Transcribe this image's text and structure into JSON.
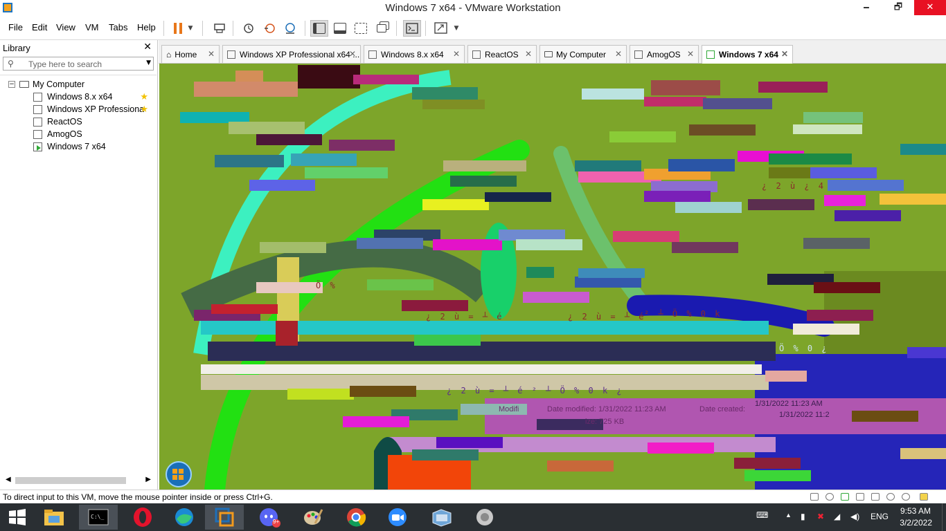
{
  "window": {
    "title": "Windows 7 x64 - VMware Workstation",
    "minimize": "🗕",
    "maximize": "🗗",
    "close": "✕"
  },
  "menu": {
    "file": "File",
    "edit": "Edit",
    "view": "View",
    "vm": "VM",
    "tabs": "Tabs",
    "help": "Help"
  },
  "toolbar_icons": [
    "pause-icon",
    "send-keys-icon",
    "snapshot-icon",
    "revert-snapshot-icon",
    "snapshot-manager-icon",
    "library-view-icon",
    "thumbnail-view-icon",
    "fullscreen-icon",
    "unity-icon",
    "console-icon",
    "stretch-icon"
  ],
  "library": {
    "title": "Library",
    "close": "✕",
    "search_placeholder": "Type here to search",
    "tree": {
      "root": "My Computer",
      "items": [
        {
          "label": "Windows 8.x x64",
          "favorite": true,
          "running": false
        },
        {
          "label": "Windows XP Professiona",
          "favorite": true,
          "running": false
        },
        {
          "label": "ReactOS",
          "favorite": false,
          "running": false
        },
        {
          "label": "AmogOS",
          "favorite": false,
          "running": false
        },
        {
          "label": "Windows 7 x64",
          "favorite": false,
          "running": true
        }
      ]
    }
  },
  "tabs": [
    {
      "label": "Home",
      "active": false
    },
    {
      "label": "Windows XP Professional x64 ...",
      "active": false
    },
    {
      "label": "Windows 8.x x64",
      "active": false
    },
    {
      "label": "ReactOS",
      "active": false
    },
    {
      "label": "My Computer",
      "active": false
    },
    {
      "label": "AmogOS",
      "active": false
    },
    {
      "label": "Windows 7 x64",
      "active": true
    }
  ],
  "vm_screen": {
    "glitch_texts": [
      "¿ 2 ù = ┴ é",
      "¿ 2 ù = ┴ é",
      "² ┴ Ö % 0 k",
      "¿ 2 ù = ┴ é  ² ┴ Ö % 0 k ¿",
      "Ö %",
      "¿ 2 ù ¿ 4",
      "Ö % 0 ¿"
    ],
    "date_texts": [
      "1/31/2022 11:23 AM",
      "1/31/2022 11:2",
      "Date modified: 1/31/2022 11:23 AM",
      "Date created:",
      "ize: 725 KB",
      "Modifi"
    ]
  },
  "status": {
    "text": "To direct input to this VM, move the mouse pointer inside or press Ctrl+G."
  },
  "taskbar": {
    "apps": [
      "start-button",
      "file-explorer-icon",
      "command-prompt-icon",
      "opera-icon",
      "edge-icon",
      "vmware-icon",
      "discord-icon",
      "paint-icon",
      "chrome-icon",
      "zoom-icon",
      "virtualbox-icon",
      "speaker-app-icon"
    ],
    "discord_badge": "9+",
    "language": "ENG",
    "time": "9:53 AM",
    "date": "3/2/2022"
  }
}
